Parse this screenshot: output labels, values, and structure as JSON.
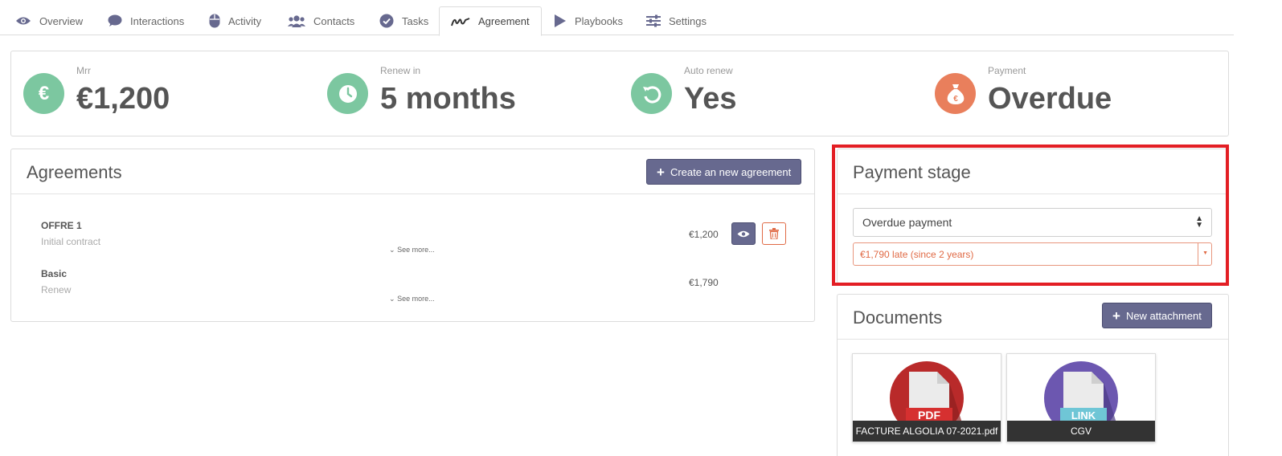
{
  "tabs": [
    {
      "label": "Overview"
    },
    {
      "label": "Interactions"
    },
    {
      "label": "Activity"
    },
    {
      "label": "Contacts"
    },
    {
      "label": "Tasks"
    },
    {
      "label": "Agreement"
    },
    {
      "label": "Playbooks"
    },
    {
      "label": "Settings"
    }
  ],
  "active_tab": "Agreement",
  "kpis": [
    {
      "label": "Mrr",
      "value": "€1,200",
      "icon": "euro-icon",
      "color": "#7cc7a0"
    },
    {
      "label": "Renew in",
      "value": "5 months",
      "icon": "clock-icon",
      "color": "#7cc7a0"
    },
    {
      "label": "Auto renew",
      "value": "Yes",
      "icon": "refresh-icon",
      "color": "#7cc7a0"
    },
    {
      "label": "Payment",
      "value": "Overdue",
      "icon": "money-bag-icon",
      "color": "#e97f5c"
    }
  ],
  "agreements": {
    "title": "Agreements",
    "create_label": "Create an new agreement",
    "items": [
      {
        "name": "OFFRE 1",
        "type": "Initial contract",
        "see_more": "See more...",
        "price": "€1,200"
      },
      {
        "name": "Basic",
        "type": "Renew",
        "see_more": "See more...",
        "price": "€1,790"
      }
    ]
  },
  "payment_stage": {
    "title": "Payment stage",
    "selected": "Overdue payment",
    "late_text": "€1,790 late (since 2 years)"
  },
  "documents": {
    "title": "Documents",
    "new_label": "New attachment",
    "items": [
      {
        "name": "FACTURE ALGOLIA 07-2021.pdf",
        "badge": "PDF"
      },
      {
        "name": "CGV",
        "badge": "LINK"
      }
    ]
  },
  "colors": {
    "accent": "#67698f",
    "kpi_green": "#7cc7a0",
    "kpi_orange": "#e97f5c",
    "danger": "#e06a45",
    "highlight_frame": "#e31e24"
  }
}
